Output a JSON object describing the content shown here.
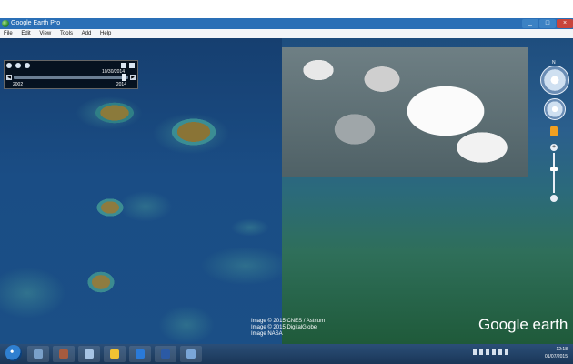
{
  "window": {
    "title": "Google Earth Pro",
    "controls": [
      "_",
      "□",
      "×"
    ]
  },
  "menu": [
    "File",
    "Edit",
    "View",
    "Tools",
    "Add",
    "Help"
  ],
  "time_slider": {
    "current_date": "10/30/2014",
    "start_year": "2002",
    "end_year": "2014"
  },
  "attribution": {
    "line1": "Image © 2015 CNES / Astrium",
    "line2": "Image © 2015 DigitalGlobe",
    "line3": "Image NASA"
  },
  "branding": {
    "text": "Google earth"
  },
  "navigation": {
    "north_label": "N"
  },
  "tray": {
    "time": "12:18",
    "date": "01/07/2015"
  },
  "taskbar_buttons": [
    {
      "name": "windows-explorer-icon",
      "color": "#f1c232"
    },
    {
      "name": "internet-explorer-icon",
      "color": "#2a7ad9"
    },
    {
      "name": "word-icon",
      "color": "#2b5aa5"
    },
    {
      "name": "google-earth-icon",
      "color": "#7aa6d8"
    }
  ]
}
